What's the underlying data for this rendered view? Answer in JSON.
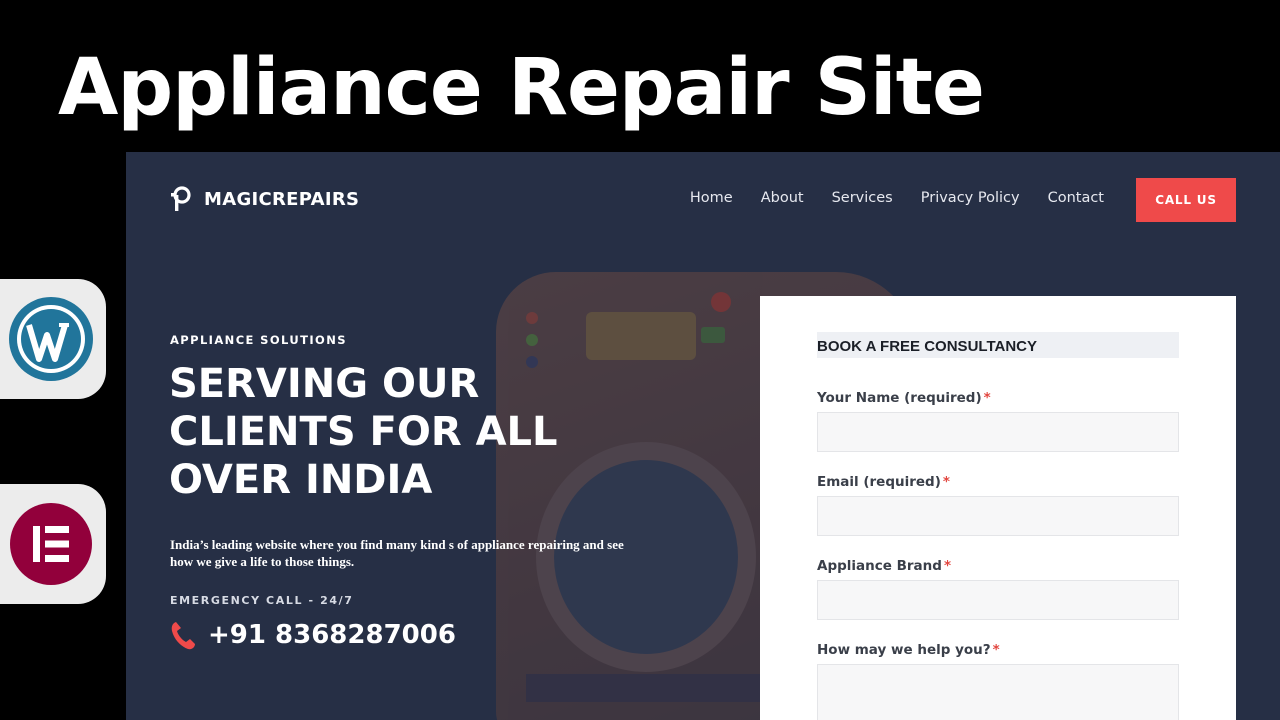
{
  "banner": {
    "title": "Appliance Repair Site"
  },
  "badges": [
    {
      "name": "wordpress-logo",
      "color": "#21759b"
    },
    {
      "name": "elementor-logo",
      "color": "#92003b"
    }
  ],
  "site": {
    "brand": "MAGICREPAIRS",
    "nav": [
      "Home",
      "About",
      "Services",
      "Privacy Policy",
      "Contact"
    ],
    "cta": "CALL US",
    "eyebrow": "APPLIANCE SOLUTIONS",
    "headline_lines": [
      "SERVING OUR",
      "CLIENTS FOR ALL",
      "OVER INDIA"
    ],
    "description": "India’s leading website where you find many kind s of appliance repairing and see how we give a life to those things.",
    "emergency": "EMERGENCY CALL - 24/7",
    "phone": "+91 8368287006"
  },
  "form": {
    "heading": "BOOK A FREE CONSULTANCY",
    "fields": [
      {
        "label": "Your Name (required)",
        "required_mark": "*",
        "value": ""
      },
      {
        "label": "Email (required)",
        "required_mark": "*",
        "value": ""
      },
      {
        "label": "Appliance Brand",
        "required_mark": "*",
        "value": ""
      },
      {
        "label": "How may we help you?",
        "required_mark": "*",
        "value": ""
      }
    ]
  },
  "colors": {
    "accent": "#ef4a4a",
    "site_bg": "#262f45"
  }
}
